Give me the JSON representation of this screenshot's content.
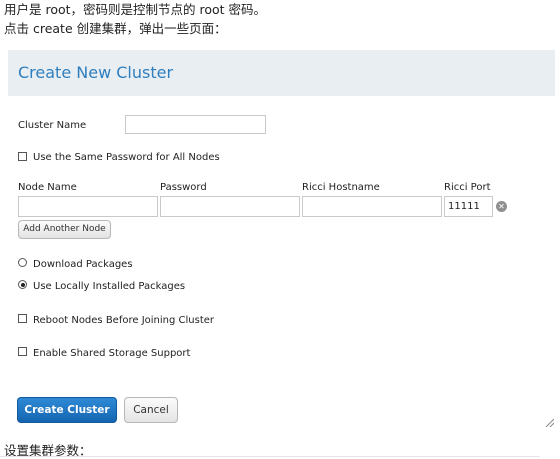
{
  "intro": {
    "line1": "用户是 root，密码则是控制节点的 root 密码。",
    "line2": "点击 create 创建集群，弹出一些页面："
  },
  "dialog": {
    "title": "Create New Cluster",
    "cluster_name_label": "Cluster Name",
    "cluster_name_value": "",
    "same_password_label": "Use the Same Password for All Nodes",
    "same_password_checked": false,
    "node_table": {
      "headers": [
        "Node Name",
        "Password",
        "Ricci Hostname",
        "Ricci Port"
      ],
      "row": {
        "node_name": "",
        "password": "",
        "ricci_hostname": "",
        "ricci_port": "11111"
      }
    },
    "remove_icon": "remove-circle-icon",
    "add_node_label": "Add Another Node",
    "package_options": [
      {
        "label": "Download Packages",
        "checked": false
      },
      {
        "label": "Use Locally Installed Packages",
        "checked": true
      }
    ],
    "reboot_label": "Reboot Nodes Before Joining Cluster",
    "reboot_checked": false,
    "shared_storage_label": "Enable Shared Storage Support",
    "shared_storage_checked": false,
    "create_label": "Create Cluster",
    "cancel_label": "Cancel"
  },
  "footer": {
    "text": "设置集群参数："
  },
  "colors": {
    "header_bg": "#e9eef2",
    "title": "#2f7fbf",
    "primary": "#1a6fbf"
  }
}
